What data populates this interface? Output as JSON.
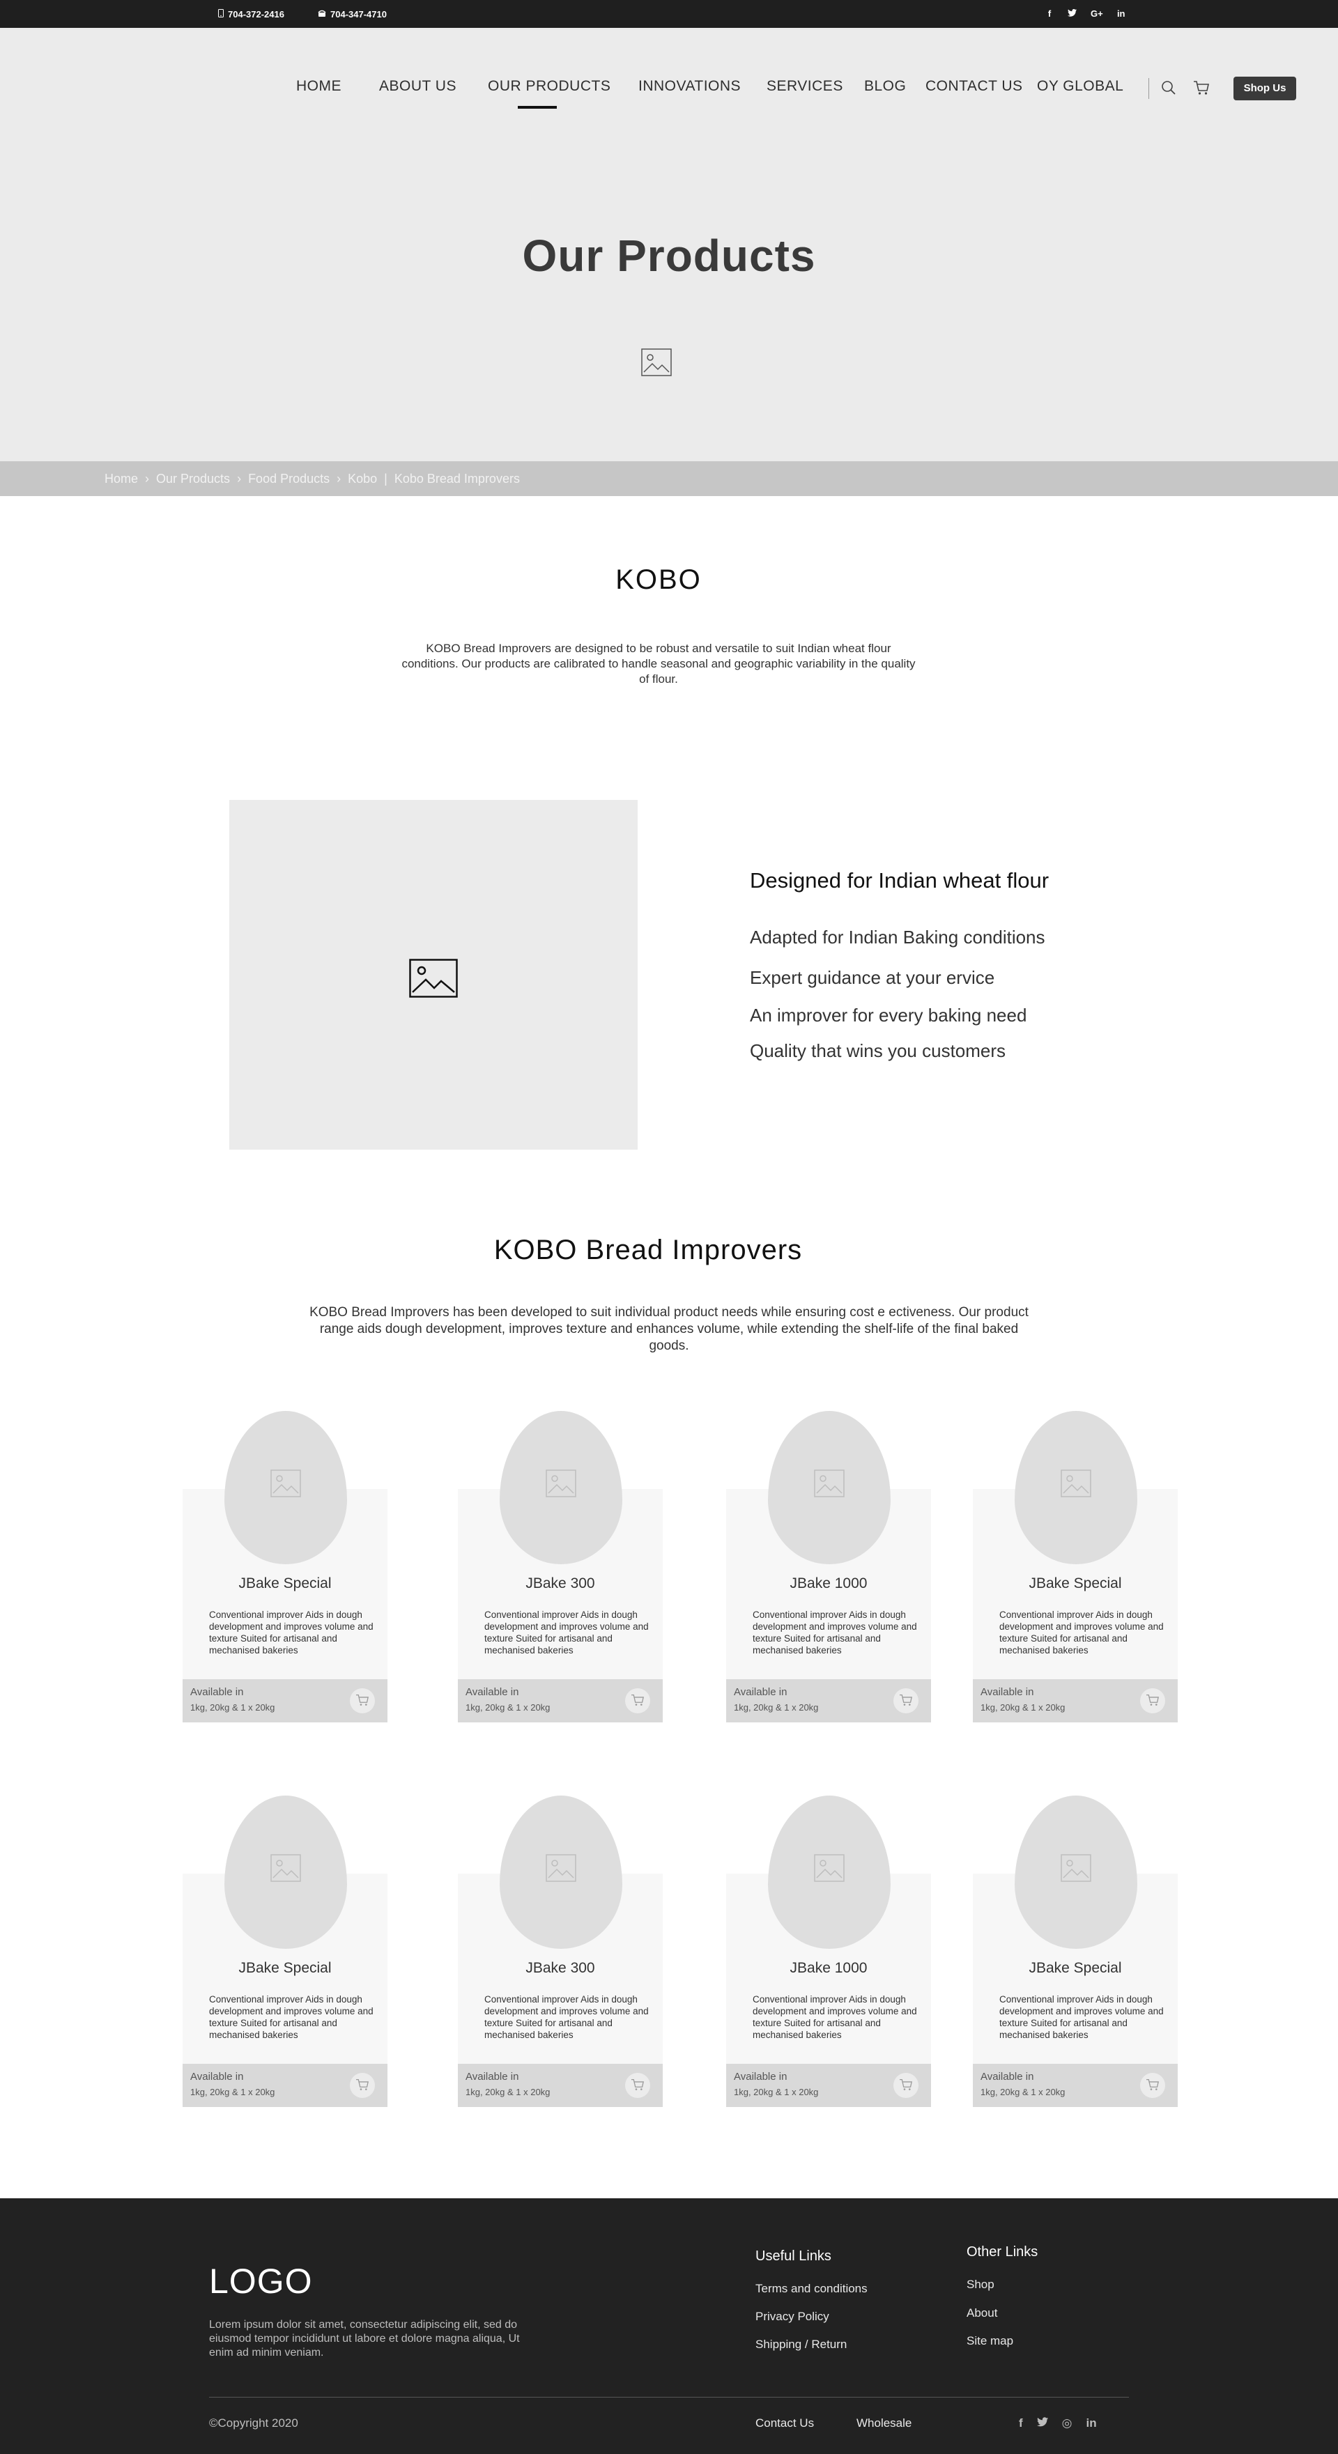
{
  "topbar": {
    "phone_1": "704-372-2416",
    "phone_2": "704-347-4710",
    "social": [
      {
        "icon": "facebook-icon",
        "glyph": "f"
      },
      {
        "icon": "twitter-icon",
        "glyph": "t"
      },
      {
        "icon": "google-plus-icon",
        "glyph": "G+"
      },
      {
        "icon": "linkedin-icon",
        "glyph": "in"
      }
    ]
  },
  "nav": {
    "items": [
      "HOME",
      "ABOUT US",
      "OUR PRODUCTS",
      "INNOVATIONS",
      "SERVICES",
      "BLOG",
      "CONTACT US",
      "OY GLOBAL"
    ],
    "active": "OUR PRODUCTS",
    "shop_button": "Shop Us",
    "icons": [
      "search-icon",
      "cart-icon"
    ]
  },
  "hero": {
    "title": "Our Products"
  },
  "breadcrumb": {
    "items": [
      "Home",
      "Our Products",
      "Food Products",
      "Kobo",
      "Kobo Bread Improvers"
    ]
  },
  "kobo": {
    "title": "KOBO",
    "description": "KOBO Bread Improvers are  designed to be robust and versatile  to suit Indian wheat flour  conditions. Our products are  calibrated to handle seasonal and geographic variability in the quality  of flour."
  },
  "feature": {
    "title": "Designed for Indian wheat flour",
    "points": [
      "Adapted for Indian Baking conditions",
      "Expert guidance at your ervice",
      "An improver for every baking need",
      "Quality that wins you customers"
    ]
  },
  "bread_improvers": {
    "title": "KOBO Bread Improvers",
    "description": "KOBO Bread Improvers has been developed to suit individual product needs while ensuring cost  e  ectiveness. Our product range aids dough development, improves texture and enhances volume, while  extending the shelf-life of the final baked goods."
  },
  "products": [
    {
      "name": "JBake Special",
      "desc": "Conventional improver Aids in dough development and improves volume and texture Suited for artisanal and mechanised bakeries",
      "available_label": "Available in",
      "sizes": "1kg, 20kg & 1 x 20kg"
    },
    {
      "name": "JBake 300",
      "desc": "Conventional improver Aids in dough development and improves volume and texture Suited for artisanal and mechanised bakeries",
      "available_label": "Available in",
      "sizes": "1kg, 20kg & 1 x 20kg"
    },
    {
      "name": "JBake 1000",
      "desc": "Conventional improver Aids in dough development and improves volume and texture Suited for artisanal and mechanised bakeries",
      "available_label": "Available in",
      "sizes": "1kg, 20kg & 1 x 20kg"
    },
    {
      "name": "JBake Special",
      "desc": "Conventional improver Aids in dough development and improves volume and texture Suited for artisanal and mechanised bakeries",
      "available_label": "Available in",
      "sizes": "1kg, 20kg & 1 x 20kg"
    },
    {
      "name": "JBake Special",
      "desc": "Conventional improver Aids in dough development and improves volume and texture Suited for artisanal and mechanised bakeries",
      "available_label": "Available in",
      "sizes": "1kg, 20kg & 1 x 20kg"
    },
    {
      "name": "JBake 300",
      "desc": "Conventional improver Aids in dough development and improves volume and texture Suited for artisanal and mechanised bakeries",
      "available_label": "Available in",
      "sizes": "1kg, 20kg & 1 x 20kg"
    },
    {
      "name": "JBake 1000",
      "desc": "Conventional improver Aids in dough development and improves volume and texture Suited for artisanal and mechanised bakeries",
      "available_label": "Available in",
      "sizes": "1kg, 20kg & 1 x 20kg"
    },
    {
      "name": "JBake Special",
      "desc": "Conventional improver Aids in dough development and improves volume and texture Suited for artisanal and mechanised bakeries",
      "available_label": "Available in",
      "sizes": "1kg, 20kg & 1 x 20kg"
    }
  ],
  "footer": {
    "logo": "LOGO",
    "description": "Lorem ipsum dolor sit amet, consectetur adipiscing elit, sed do eiusmod tempor incididunt ut labore et dolore magna aliqua, Ut enim ad minim veniam.",
    "useful_links": {
      "title": "Useful Links",
      "items": [
        "Terms and conditions",
        "Privacy Policy",
        "Shipping  /  Return"
      ]
    },
    "other_links": {
      "title": "Other Links",
      "items": [
        "Shop",
        "About",
        "Site map"
      ]
    },
    "copyright": "©Copyright 2020",
    "bottom_links": [
      "Contact Us",
      "Wholesale"
    ],
    "social": [
      {
        "icon": "facebook-icon",
        "glyph": "f"
      },
      {
        "icon": "twitter-icon",
        "glyph": "t"
      },
      {
        "icon": "instagram-icon",
        "glyph": "◎"
      },
      {
        "icon": "linkedin-icon",
        "glyph": "in"
      }
    ]
  },
  "colors": {
    "topbar_bg": "#1f1f1f",
    "hero_bg": "#ebebeb",
    "breadcrumb_bg": "#c6c6c6",
    "footer_bg": "#222222",
    "shop_button_bg": "#3a3a3a"
  }
}
